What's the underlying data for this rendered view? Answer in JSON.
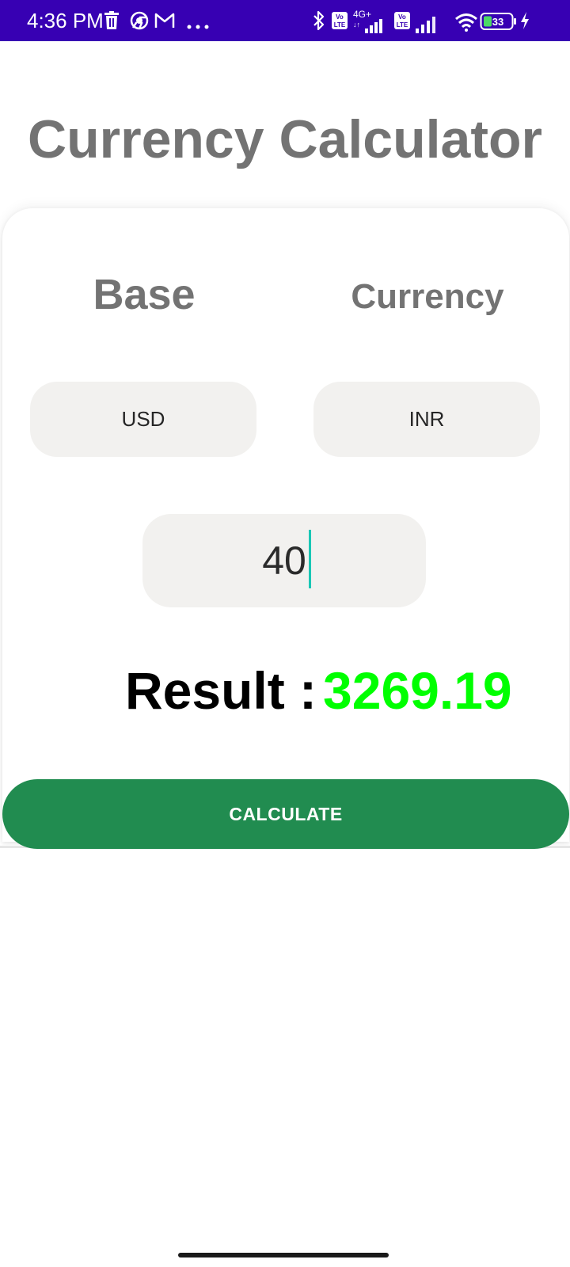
{
  "status_bar": {
    "time": "4:36 PM",
    "battery": "33",
    "icons": [
      "trash-icon",
      "chrome-icon",
      "gmail-icon",
      "more-icon",
      "bluetooth-icon",
      "volte-icon",
      "signal-4g-icon",
      "volte-icon",
      "signal-icon",
      "wifi-icon",
      "battery-icon",
      "charging-icon"
    ],
    "network_label": "4G+",
    "volte_label": "Vo LTE"
  },
  "app": {
    "title": "Currency Calculator",
    "base_label": "Base",
    "currency_label": "Currency",
    "base_currency": "USD",
    "target_currency": "INR",
    "amount": "40",
    "result_label": "Result :",
    "result_value": "3269.19",
    "calculate_label": "CALCULATE"
  },
  "colors": {
    "status_bar": "#3700b3",
    "title_text": "#737373",
    "result_value": "#00ff00",
    "button": "#218c50",
    "field_bg": "#f2f1ef",
    "caret": "#19c7b5"
  }
}
